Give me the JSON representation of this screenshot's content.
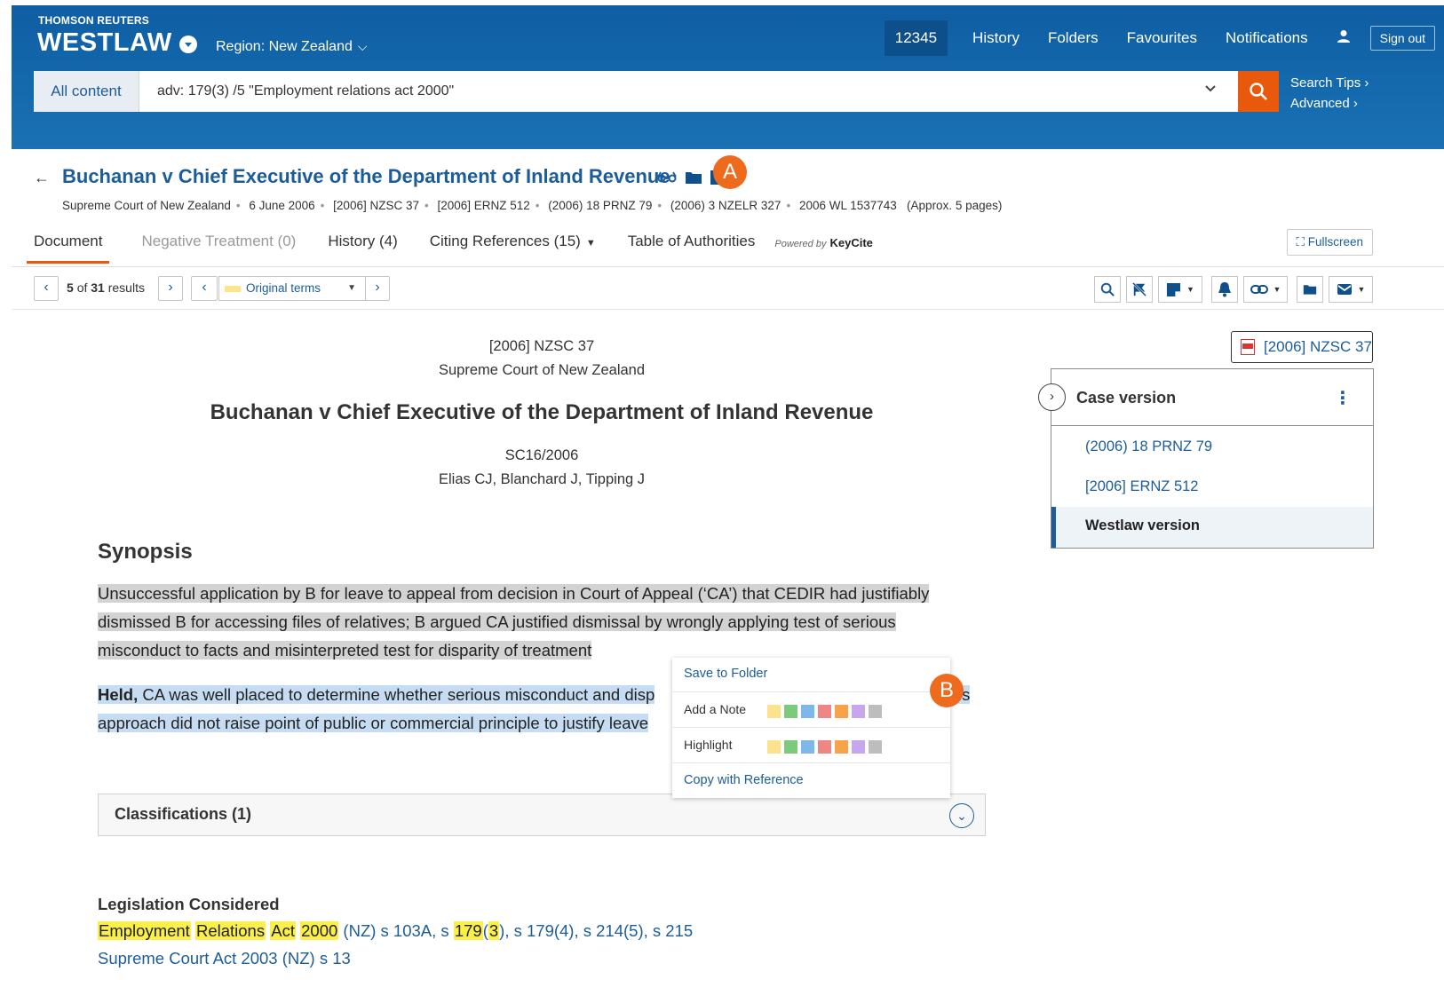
{
  "header": {
    "brand_top": "THOMSON REUTERS",
    "brand_main": "WESTLAW",
    "region": "Region: New Zealand",
    "account": "12345",
    "nav": [
      "History",
      "Folders",
      "Favourites",
      "Notifications"
    ],
    "sign_out": "Sign out",
    "search_scope": "All content",
    "search_query": "adv: 179(3) /5 \"Employment relations act 2000\"",
    "search_tips": "Search Tips",
    "advanced": "Advanced"
  },
  "document": {
    "title": "Buchanan v Chief Executive of the Department of Inland Revenue",
    "citations": [
      "Supreme Court of New Zealand",
      "6 June 2006",
      "[2006] NZSC 37",
      "[2006] ERNZ 512",
      "(2006) 18 PRNZ 79",
      "(2006) 3 NZELR 327",
      "2006 WL 1537743"
    ],
    "pages": "(Approx. 5 pages)",
    "markers": {
      "a": "A",
      "b": "B"
    }
  },
  "tabs": {
    "document": "Document",
    "negative": "Negative Treatment (0)",
    "history": "History (4)",
    "citing": "Citing References (15)",
    "authorities": "Table of Authorities",
    "powered_by": "Powered by",
    "keycite": "KeyCite",
    "fullscreen": "Fullscreen"
  },
  "toolbar": {
    "result_current": "5",
    "result_of": "of",
    "result_total": "31",
    "result_word": "results",
    "terms": "Original terms"
  },
  "body": {
    "neutral_cite": "[2006] NZSC 37",
    "court": "Supreme Court of New Zealand",
    "case_title": "Buchanan v Chief Executive of the Department of Inland Revenue",
    "file_no": "SC16/2006",
    "judges": "Elias CJ, Blanchard J, Tipping J",
    "synopsis_heading": "Synopsis",
    "synopsis_lines": [
      "Unsuccessful application by B for leave to appeal from decision in Court of Appeal (‘CA’) that CEDIR had justifiably",
      "dismissed B for accessing files of relatives; B argued CA justified dismissal by wrongly applying test of serious",
      "misconduct to facts and misinterpreted test for disparity of treatment"
    ],
    "held_bold": "Held,",
    "held_line1": " CA was well placed to determine whether serious misconduct and disp",
    "held_tail": "A's",
    "held_line2": "approach did not raise point of public or commercial principle to justify leave",
    "classifications": "Classifications (1)",
    "legislation_heading": "Legislation Considered",
    "leg1_parts": [
      "Employment",
      "Relations",
      "Act",
      "2000",
      "(NZ) s 103A, s",
      "179",
      "(",
      "3",
      "), s 179(4), s 214(5), s 215"
    ],
    "leg2": "Supreme Court Act 2003 (NZ) s 13"
  },
  "case_version": {
    "heading": "Case version",
    "items": [
      "(2006) 18 PRNZ 79",
      "[2006] ERNZ 512"
    ],
    "selected": "Westlaw version",
    "pdf_label": "[2006] NZSC 37"
  },
  "popup": {
    "save": "Save to Folder",
    "note": "Add a Note",
    "highlight": "Highlight",
    "copy": "Copy with Reference",
    "colors": [
      "#fbe38e",
      "#7ccb7a",
      "#7fb8e8",
      "#ef8585",
      "#f6a34a",
      "#c7a6ec",
      "#bdbdbd"
    ]
  }
}
